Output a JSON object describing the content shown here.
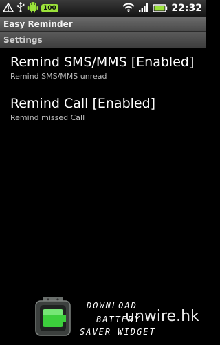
{
  "status_bar": {
    "battery_badge": "100",
    "clock": "22:32",
    "icons": [
      "warning-icon",
      "usb-icon",
      "android-icon",
      "wifi-icon",
      "signal-icon",
      "battery-icon"
    ]
  },
  "app": {
    "title": "Easy Reminder"
  },
  "settings": {
    "category": "Settings",
    "items": [
      {
        "title": "Remind SMS/MMS [Enabled]",
        "summary": "Remind SMS/MMS unread"
      },
      {
        "title": "Remind Call [Enabled]",
        "summary": "Remind missed Call"
      }
    ]
  },
  "banner": {
    "line1": "DOWNLOAD",
    "line2": "BATTERY",
    "line3": "SAVER WIDGET",
    "watermark": "unwire.hk"
  },
  "colors": {
    "battery_green": "#9be23a",
    "background": "#000000"
  }
}
